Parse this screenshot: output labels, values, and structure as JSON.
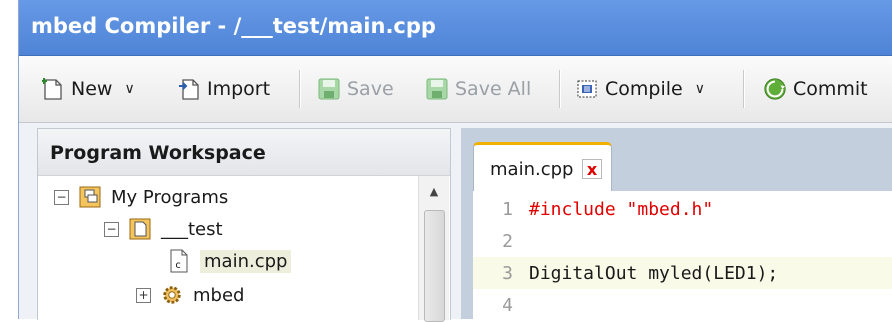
{
  "window": {
    "title": "mbed Compiler - /___test/main.cpp"
  },
  "toolbar": {
    "new_label": "New",
    "import_label": "Import",
    "save_label": "Save",
    "save_all_label": "Save All",
    "compile_label": "Compile",
    "commit_label": "Commit"
  },
  "workspace": {
    "header": "Program Workspace",
    "tree": [
      {
        "label": "My Programs",
        "icon": "programs-folder-icon",
        "toggle": "−"
      },
      {
        "label": "___test",
        "icon": "program-icon",
        "toggle": "−"
      },
      {
        "label": "main.cpp",
        "icon": "cpp-file-icon",
        "selected": true
      },
      {
        "label": "mbed",
        "icon": "library-gear-icon",
        "toggle": "+"
      }
    ]
  },
  "editor": {
    "tab_label": "main.cpp",
    "close_glyph": "x",
    "lines": [
      {
        "num": "1",
        "text": "#include \"mbed.h\""
      },
      {
        "num": "2",
        "text": ""
      },
      {
        "num": "3",
        "text": "DigitalOut myled(LED1);"
      },
      {
        "num": "4",
        "text": ""
      }
    ]
  },
  "colors": {
    "titlebar": "#5c8fdc",
    "tab_accent": "#f0b000",
    "preprocessor": "#e00000",
    "current_line": "#fafae8"
  }
}
